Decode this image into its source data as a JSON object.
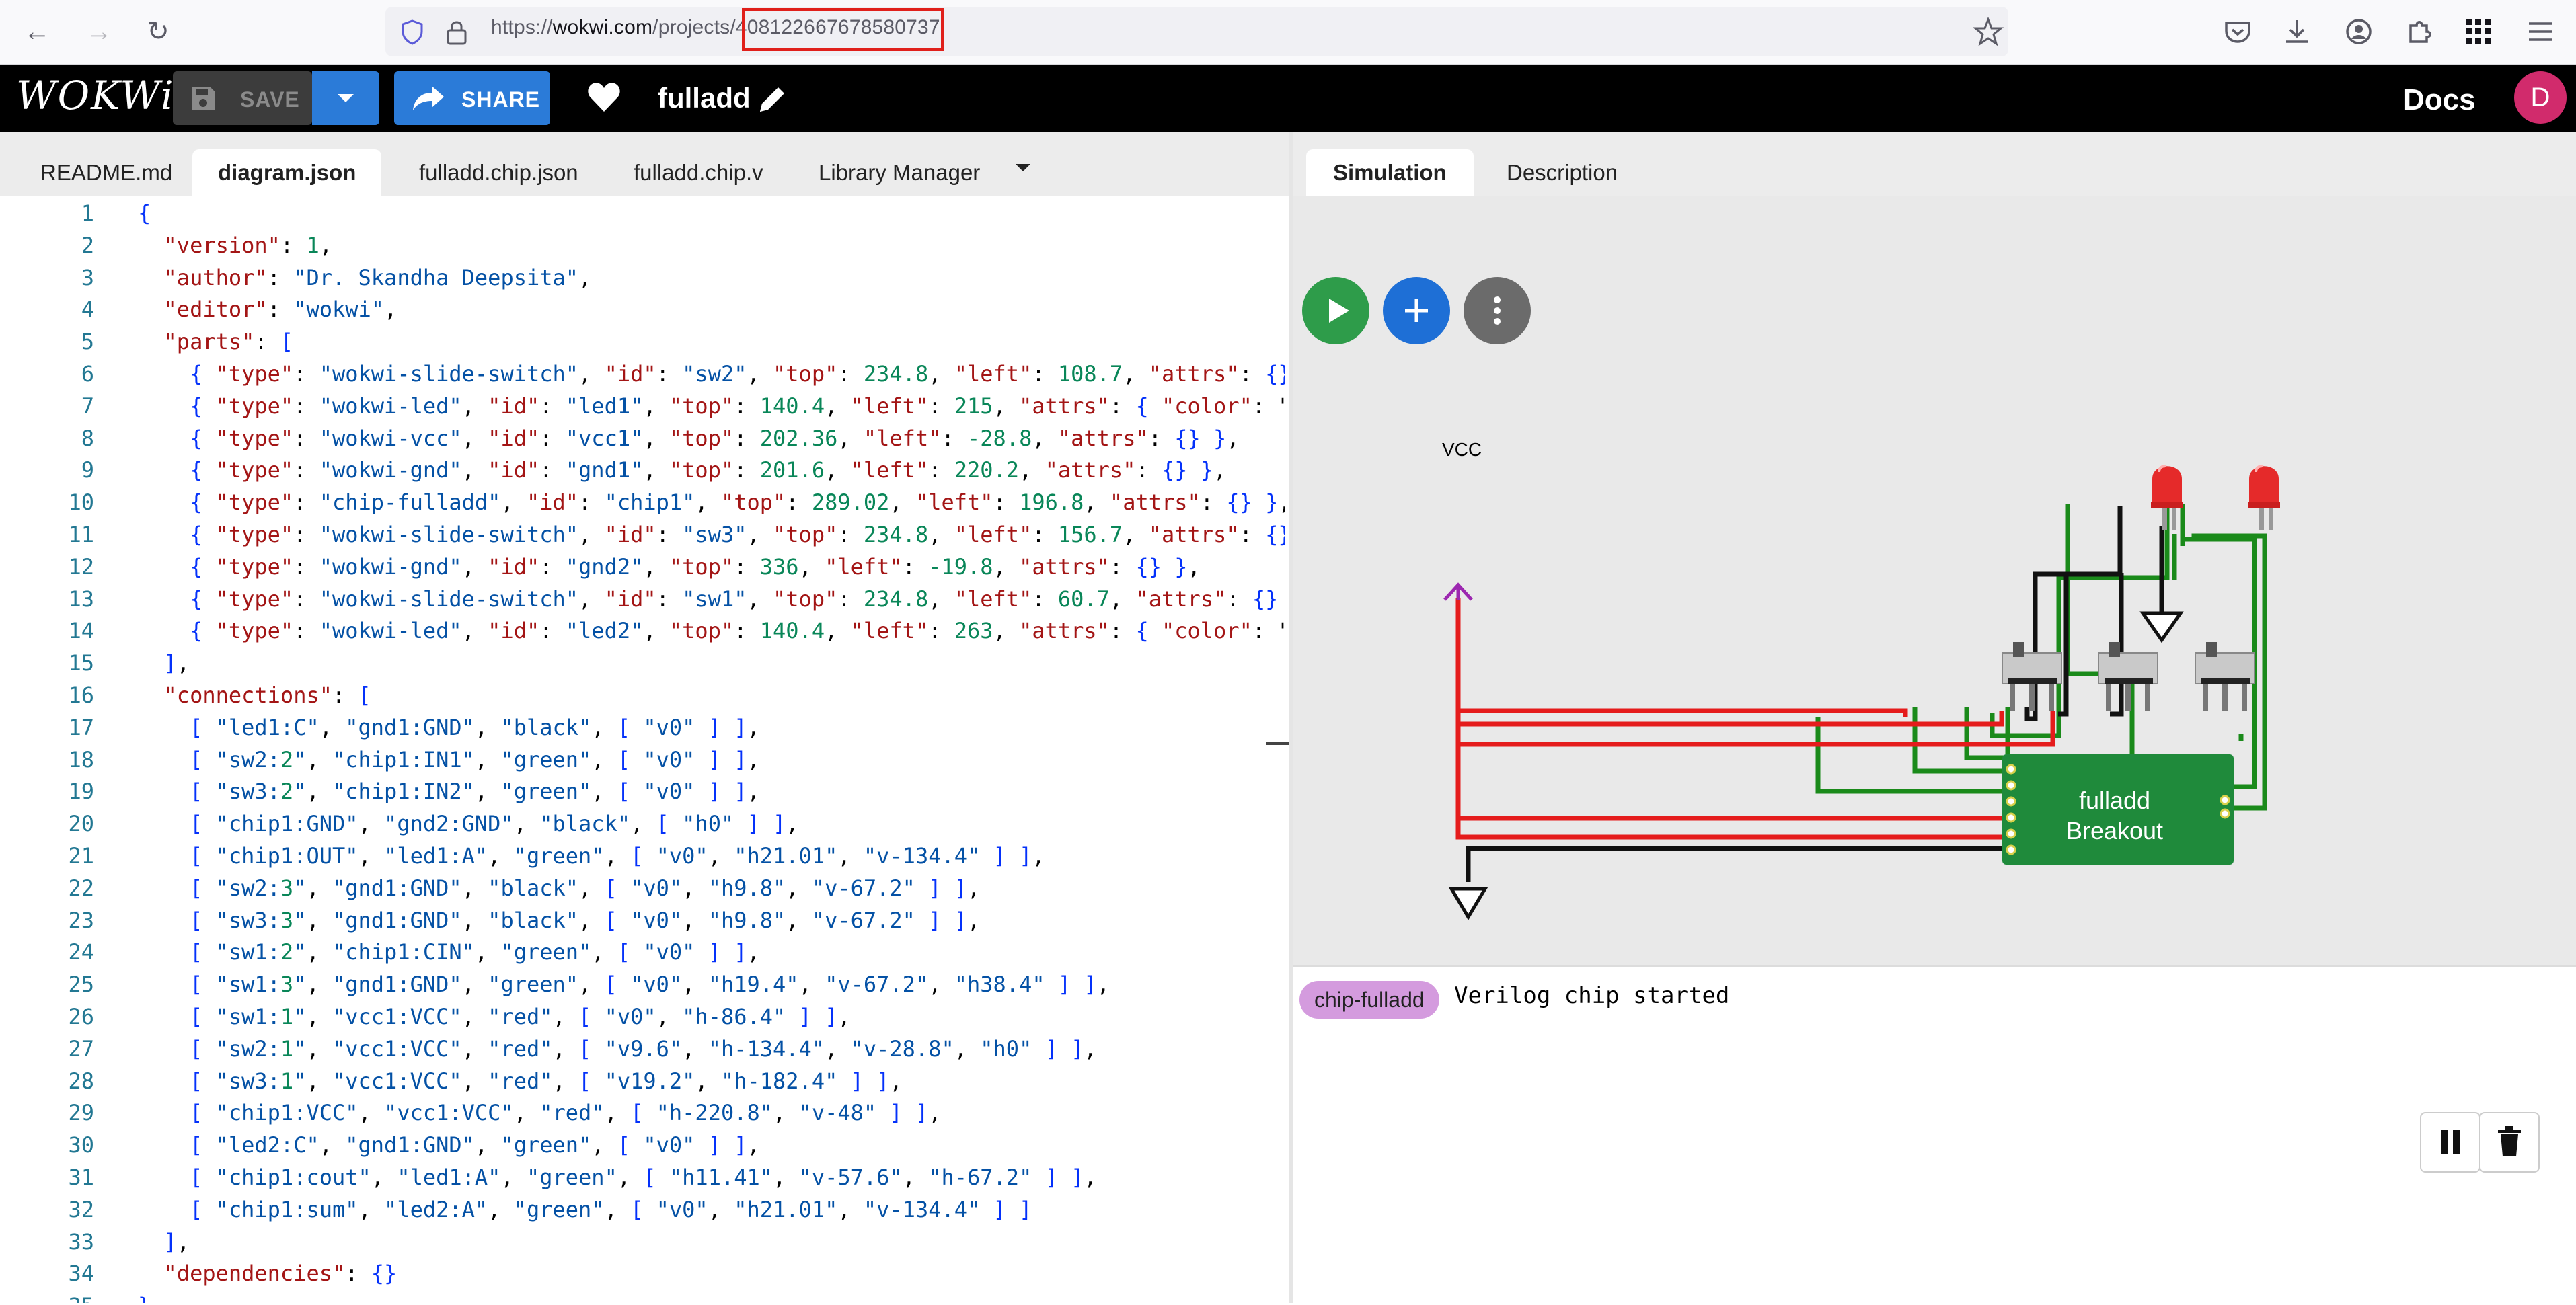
{
  "browser": {
    "url_scheme": "https://",
    "url_host": "wokwi.com",
    "url_path": "/projects/",
    "url_id": "408122667678580737"
  },
  "header": {
    "logo": "WOKWi",
    "save_label": "SAVE",
    "share_label": "SHARE",
    "project_name": "fulladd",
    "docs_label": "Docs",
    "avatar_initial": "D",
    "colors": {
      "bar": "#000000",
      "primary_button": "#2b7bd8",
      "avatar": "#d12b6c"
    }
  },
  "editor": {
    "tabs": [
      "README.md",
      "diagram.json",
      "fulladd.chip.json",
      "fulladd.chip.v",
      "Library Manager"
    ],
    "active_tab": "diagram.json",
    "lines": [
      "{",
      "  \"version\": 1,",
      "  \"author\": \"Dr. Skandha Deepsita\",",
      "  \"editor\": \"wokwi\",",
      "  \"parts\": [",
      "    { \"type\": \"wokwi-slide-switch\", \"id\": \"sw2\", \"top\": 234.8, \"left\": 108.7, \"attrs\": {}",
      "    { \"type\": \"wokwi-led\", \"id\": \"led1\", \"top\": 140.4, \"left\": 215, \"attrs\": { \"color\": \"",
      "    { \"type\": \"wokwi-vcc\", \"id\": \"vcc1\", \"top\": 202.36, \"left\": -28.8, \"attrs\": {} },",
      "    { \"type\": \"wokwi-gnd\", \"id\": \"gnd1\", \"top\": 201.6, \"left\": 220.2, \"attrs\": {} },",
      "    { \"type\": \"chip-fulladd\", \"id\": \"chip1\", \"top\": 289.02, \"left\": 196.8, \"attrs\": {} },",
      "    { \"type\": \"wokwi-slide-switch\", \"id\": \"sw3\", \"top\": 234.8, \"left\": 156.7, \"attrs\": {}",
      "    { \"type\": \"wokwi-gnd\", \"id\": \"gnd2\", \"top\": 336, \"left\": -19.8, \"attrs\": {} },",
      "    { \"type\": \"wokwi-slide-switch\", \"id\": \"sw1\", \"top\": 234.8, \"left\": 60.7, \"attrs\": {}",
      "    { \"type\": \"wokwi-led\", \"id\": \"led2\", \"top\": 140.4, \"left\": 263, \"attrs\": { \"color\": \"",
      "  ],",
      "  \"connections\": [",
      "    [ \"led1:C\", \"gnd1:GND\", \"black\", [ \"v0\" ] ],",
      "    [ \"sw2:2\", \"chip1:IN1\", \"green\", [ \"v0\" ] ],",
      "    [ \"sw3:2\", \"chip1:IN2\", \"green\", [ \"v0\" ] ],",
      "    [ \"chip1:GND\", \"gnd2:GND\", \"black\", [ \"h0\" ] ],",
      "    [ \"chip1:OUT\", \"led1:A\", \"green\", [ \"v0\", \"h21.01\", \"v-134.4\" ] ],",
      "    [ \"sw2:3\", \"gnd1:GND\", \"black\", [ \"v0\", \"h9.8\", \"v-67.2\" ] ],",
      "    [ \"sw3:3\", \"gnd1:GND\", \"black\", [ \"v0\", \"h9.8\", \"v-67.2\" ] ],",
      "    [ \"sw1:2\", \"chip1:CIN\", \"green\", [ \"v0\" ] ],",
      "    [ \"sw1:3\", \"gnd1:GND\", \"green\", [ \"v0\", \"h19.4\", \"v-67.2\", \"h38.4\" ] ],",
      "    [ \"sw1:1\", \"vcc1:VCC\", \"red\", [ \"v0\", \"h-86.4\" ] ],",
      "    [ \"sw2:1\", \"vcc1:VCC\", \"red\", [ \"v9.6\", \"h-134.4\", \"v-28.8\", \"h0\" ] ],",
      "    [ \"sw3:1\", \"vcc1:VCC\", \"red\", [ \"v19.2\", \"h-182.4\" ] ],",
      "    [ \"chip1:VCC\", \"vcc1:VCC\", \"red\", [ \"h-220.8\", \"v-48\" ] ],",
      "    [ \"led2:C\", \"gnd1:GND\", \"green\", [ \"v0\" ] ],",
      "    [ \"chip1:cout\", \"led1:A\", \"green\", [ \"h11.41\", \"v-57.6\", \"h-67.2\" ] ],",
      "    [ \"chip1:sum\", \"led2:A\", \"green\", [ \"v0\", \"h21.01\", \"v-134.4\" ] ]",
      "  ],",
      "  \"dependencies\": {}",
      "}"
    ]
  },
  "simulation": {
    "tabs": [
      "Simulation",
      "Description"
    ],
    "active_tab": "Simulation",
    "vcc_label": "VCC",
    "chip_label_line1": "fulladd",
    "chip_label_line2": "Breakout",
    "console_badge": "chip-fulladd",
    "console_message": "Verilog chip started",
    "colors": {
      "play": "#2e9c4a",
      "add": "#1e6fd6",
      "menu": "#6b6b6b",
      "chip": "#1f8a3b",
      "led": "#e52a2a",
      "wire_red": "#e51c1c",
      "wire_green": "#1a8a1a"
    }
  }
}
